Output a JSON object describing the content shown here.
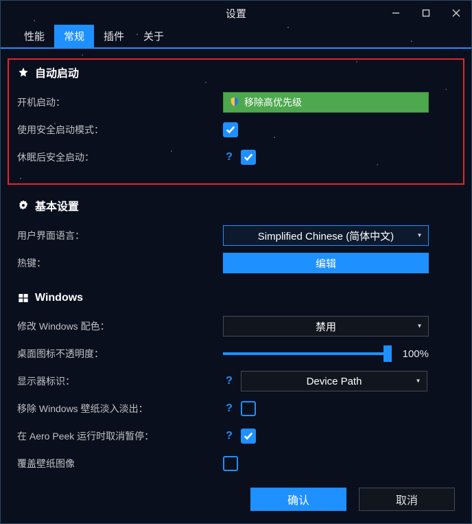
{
  "window": {
    "title": "设置"
  },
  "tabs": [
    {
      "label": "性能",
      "active": false
    },
    {
      "label": "常规",
      "active": true
    },
    {
      "label": "插件",
      "active": false
    },
    {
      "label": "关于",
      "active": false
    }
  ],
  "sections": {
    "autostart": {
      "title": "自动启动",
      "icon": "star-icon",
      "highlighted": true,
      "rows": {
        "boot_autostart": {
          "label": "开机启动：",
          "button_label": "移除高优先级"
        },
        "safe_start": {
          "label": "使用安全启动模式：",
          "checked": true
        },
        "safe_after_sleep": {
          "label": "休眠后安全启动：",
          "help": true,
          "checked": true
        }
      }
    },
    "basic": {
      "title": "基本设置",
      "icon": "gear-icon",
      "rows": {
        "language": {
          "label": "用户界面语言：",
          "value": "Simplified Chinese (简体中文)"
        },
        "hotkey": {
          "label": "热键：",
          "button_label": "编辑"
        }
      }
    },
    "windows": {
      "title": "Windows",
      "icon": "windows-icon",
      "rows": {
        "color_scheme": {
          "label": "修改 Windows 配色：",
          "value": "禁用"
        },
        "icon_opacity": {
          "label": "桌面图标不透明度：",
          "value": 100,
          "display": "100%"
        },
        "monitor_id": {
          "label": "显示器标识：",
          "help": true,
          "value": "Device Path"
        },
        "remove_fade": {
          "label": "移除 Windows 壁纸淡入淡出：",
          "help": true,
          "checked": false
        },
        "aero_peek": {
          "label": "在 Aero Peek 运行时取消暂停：",
          "help": true,
          "checked": true
        },
        "override_wallpaper": {
          "label": "覆盖壁纸图像",
          "checked": false
        }
      }
    }
  },
  "footer": {
    "ok": "确认",
    "cancel": "取消"
  },
  "colors": {
    "accent": "#1e90ff",
    "danger_border": "#e2252b",
    "green": "#4ea84e"
  }
}
